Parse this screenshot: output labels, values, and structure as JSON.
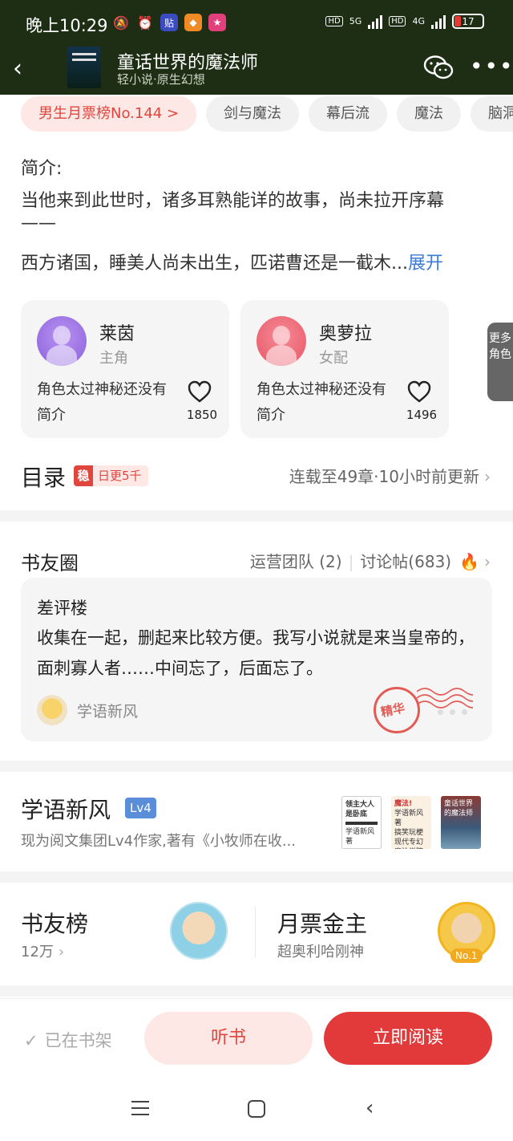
{
  "status_bar": {
    "time": "晚上10:29",
    "icons": [
      "mute-icon",
      "alarm-icon",
      "app-tie-icon",
      "app-orange-icon",
      "app-pink-icon"
    ],
    "network_1": "5G",
    "network_2": "4G",
    "hd": "HD",
    "battery": "17"
  },
  "header": {
    "title": "童话世界的魔法师",
    "subtitle": "轻小说·原生幻想",
    "background": "#1d2e14"
  },
  "tags": [
    "男生月票榜No.144 >",
    "剑与魔法",
    "幕后流",
    "魔法",
    "脑洞"
  ],
  "intro": {
    "label": "简介:",
    "line1": "当他来到此世时，诸多耳熟能详的故事，尚未拉开序幕",
    "line2": "——",
    "line3": "西方诸国，睡美人尚未出生，匹诺曹还是一截木...",
    "expand": "展开"
  },
  "characters": [
    {
      "name": "莱茵",
      "role": "主角",
      "desc": "角色太过神秘还没有简介",
      "likes": "1850",
      "color": "#a77de8"
    },
    {
      "name": "奥萝拉",
      "role": "女配",
      "desc": "角色太过神秘还没有简介",
      "likes": "1496",
      "color": "#f06a78"
    }
  ],
  "more_roles": "更多角色",
  "catalog": {
    "title": "目录",
    "badge_mark": "稳",
    "badge": "日更5千",
    "status": "连载至49章·10小时前更新"
  },
  "circle": {
    "title": "书友圈",
    "team": "运营团队 (2)",
    "posts": "讨论帖(683)",
    "post_title": "差评楼",
    "post_body": "收集在一起，删起来比较方便。我写小说就是来当皇帝的，面刺寡人者……中间忘了，后面忘了。",
    "post_author": "学语新风",
    "stamp": "精华"
  },
  "author": {
    "name": "学语新风",
    "level": "Lv4",
    "desc": "现为阅文集团Lv4作家,著有《小牧师在收...",
    "books": [
      {
        "title": "领主大人是卧底",
        "author": "学语新风著"
      },
      {
        "title": "魔法!",
        "sub": "学语新风著",
        "slogan": "搞笑玩梗现代专幻魔法学院"
      },
      {
        "title": "童话世界的魔法师"
      }
    ]
  },
  "ranks": {
    "fans_title": "书友榜",
    "fans_count": "12万",
    "ticket_title": "月票金主",
    "ticket_user": "超奥利哈刚神",
    "ticket_badge": "No.1"
  },
  "actions": {
    "shelf": "已在书架",
    "listen": "听书",
    "read": "立即阅读"
  },
  "colors": {
    "accent": "#e23a3a",
    "accent_light": "#fde8e6",
    "link": "#3a7bd5"
  }
}
